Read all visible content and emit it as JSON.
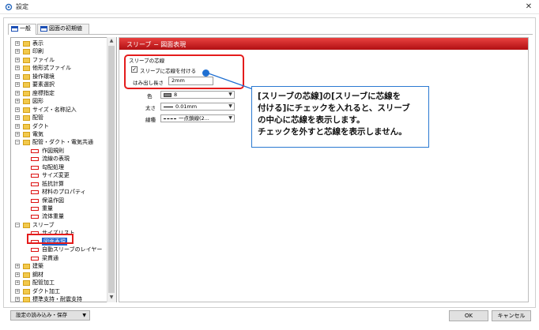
{
  "window": {
    "title": "設定",
    "close_glyph": "✕"
  },
  "tabs": [
    {
      "label": "一般"
    },
    {
      "label": "図面の初期値"
    }
  ],
  "tree": [
    {
      "label": "表示",
      "kind": "folder",
      "level": 0,
      "expand": "+"
    },
    {
      "label": "印刷",
      "kind": "folder",
      "level": 0,
      "expand": "+"
    },
    {
      "label": "ファイル",
      "kind": "folder",
      "level": 0,
      "expand": "+"
    },
    {
      "label": "他形式ファイル",
      "kind": "folder",
      "level": 0,
      "expand": "+"
    },
    {
      "label": "操作環境",
      "kind": "folder",
      "level": 0,
      "expand": "+"
    },
    {
      "label": "要素選択",
      "kind": "folder",
      "level": 0,
      "expand": "+"
    },
    {
      "label": "座標指定",
      "kind": "folder",
      "level": 0,
      "expand": "+"
    },
    {
      "label": "図形",
      "kind": "folder",
      "level": 0,
      "expand": "+"
    },
    {
      "label": "サイズ・名称記入",
      "kind": "folder",
      "level": 0,
      "expand": "+"
    },
    {
      "label": "配管",
      "kind": "folder",
      "level": 0,
      "expand": "+"
    },
    {
      "label": "ダクト",
      "kind": "folder",
      "level": 0,
      "expand": "+"
    },
    {
      "label": "電気",
      "kind": "folder",
      "level": 0,
      "expand": "+"
    },
    {
      "label": "配管・ダクト・電気共通",
      "kind": "folder",
      "level": 0,
      "expand": "−"
    },
    {
      "label": "作図規則",
      "kind": "item",
      "level": 1
    },
    {
      "label": "流線の表現",
      "kind": "item",
      "level": 1
    },
    {
      "label": "勾配処理",
      "kind": "item",
      "level": 1
    },
    {
      "label": "サイズ変更",
      "kind": "item",
      "level": 1
    },
    {
      "label": "抵抗計算",
      "kind": "item",
      "level": 1
    },
    {
      "label": "材料のプロパティ",
      "kind": "item",
      "level": 1
    },
    {
      "label": "保温作図",
      "kind": "item",
      "level": 1
    },
    {
      "label": "重量",
      "kind": "item",
      "level": 1
    },
    {
      "label": "流体重量",
      "kind": "item",
      "level": 1
    },
    {
      "label": "スリーブ",
      "kind": "folder",
      "level": 0,
      "expand": "−"
    },
    {
      "label": "サイズリスト",
      "kind": "item",
      "level": 1
    },
    {
      "label": "図面表現",
      "kind": "item",
      "level": 1,
      "selected": true
    },
    {
      "label": "自動スリーブのレイヤー",
      "kind": "item",
      "level": 1
    },
    {
      "label": "梁貫通",
      "kind": "item",
      "level": 1
    },
    {
      "label": "建築",
      "kind": "folder",
      "level": 0,
      "expand": "+"
    },
    {
      "label": "鋼材",
      "kind": "folder",
      "level": 0,
      "expand": "+"
    },
    {
      "label": "配管加工",
      "kind": "folder",
      "level": 0,
      "expand": "+"
    },
    {
      "label": "ダクト加工",
      "kind": "folder",
      "level": 0,
      "expand": "+"
    },
    {
      "label": "標準支持・耐震支持",
      "kind": "folder",
      "level": 0,
      "expand": "+"
    }
  ],
  "panel": {
    "title": "スリーブ − 図面表現",
    "group_title": "スリーブの芯線",
    "checkbox_label": "スリーブに芯線を付ける",
    "checkbox_checked": true,
    "checkmark": "✓",
    "extension_label": "はみ出し長さ",
    "extension_value": "2mm",
    "color_label": "色",
    "color_value": "8",
    "color_swatch": "#7f7f7f",
    "thickness_label": "太さ",
    "thickness_value": "0.01mm",
    "linetype_label": "線種",
    "linetype_value": "一点鎖線(2..."
  },
  "callout": {
    "lines": [
      "[スリーブの芯線]の[スリーブに芯線を",
      "付ける]にチェックを入れると、スリーブ",
      "の中心に芯線を表示します。",
      "チェックを外すと芯線を表示しません。"
    ],
    "accent": "#e41c1c",
    "border": "#2a79d1"
  },
  "bottom": {
    "import_label": "設定の読み込み・保存",
    "ok_label": "OK",
    "cancel_label": "キャンセル"
  }
}
